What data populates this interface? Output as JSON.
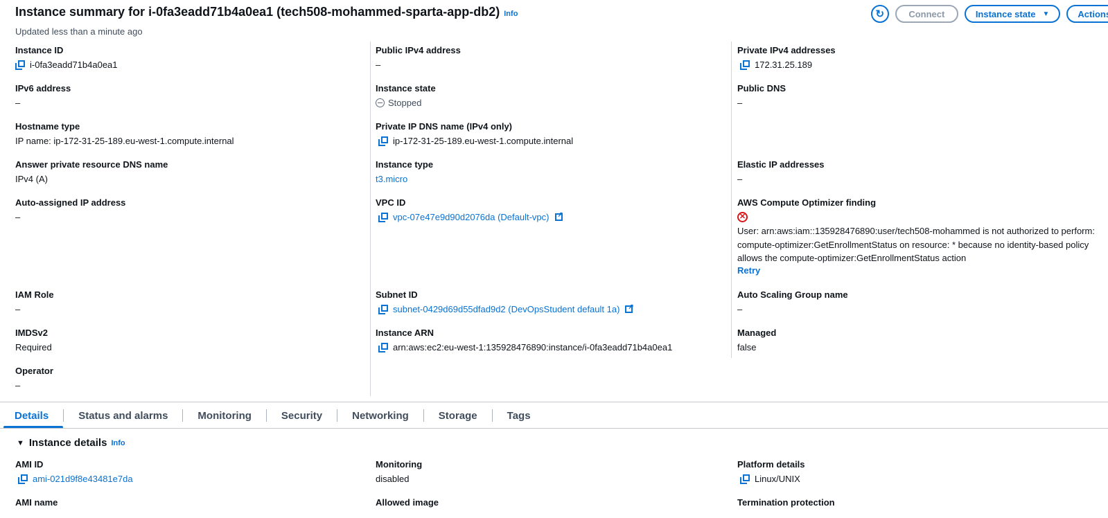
{
  "header": {
    "title": "Instance summary for i-0fa3eadd71b4a0ea1 (tech508-mohammed-sparta-app-db2)",
    "info": "Info",
    "updated": "Updated less than a minute ago"
  },
  "toolbar": {
    "refresh_icon": "refresh-icon",
    "connect": "Connect",
    "instance_state": "Instance state",
    "actions": "Actions"
  },
  "summary": {
    "instance_id": {
      "label": "Instance ID",
      "value": "i-0fa3eadd71b4a0ea1"
    },
    "ipv6": {
      "label": "IPv6 address",
      "value": "–"
    },
    "hostname_type": {
      "label": "Hostname type",
      "value": "IP name: ip-172-31-25-189.eu-west-1.compute.internal"
    },
    "answer_dns": {
      "label": "Answer private resource DNS name",
      "value": "IPv4 (A)"
    },
    "auto_ip": {
      "label": "Auto-assigned IP address",
      "value": "–"
    },
    "iam_role": {
      "label": "IAM Role",
      "value": "–"
    },
    "imdsv2": {
      "label": "IMDSv2",
      "value": "Required"
    },
    "operator": {
      "label": "Operator",
      "value": "–"
    },
    "public_ipv4": {
      "label": "Public IPv4 address",
      "value": "–"
    },
    "instance_state": {
      "label": "Instance state",
      "value": "Stopped"
    },
    "private_dns": {
      "label": "Private IP DNS name (IPv4 only)",
      "value": "ip-172-31-25-189.eu-west-1.compute.internal"
    },
    "instance_type": {
      "label": "Instance type",
      "value": "t3.micro"
    },
    "vpc_id": {
      "label": "VPC ID",
      "value": "vpc-07e47e9d90d2076da (Default-vpc)"
    },
    "subnet_id": {
      "label": "Subnet ID",
      "value": "subnet-0429d69d55dfad9d2 (DevOpsStudent default 1a)"
    },
    "instance_arn": {
      "label": "Instance ARN",
      "value": "arn:aws:ec2:eu-west-1:135928476890:instance/i-0fa3eadd71b4a0ea1"
    },
    "private_ipv4": {
      "label": "Private IPv4 addresses",
      "value": "172.31.25.189"
    },
    "public_dns": {
      "label": "Public DNS",
      "value": "–"
    },
    "elastic_ip": {
      "label": "Elastic IP addresses",
      "value": "–"
    },
    "optimizer": {
      "label": "AWS Compute Optimizer finding",
      "message": "User: arn:aws:iam::135928476890:user/tech508-mohammed is not authorized to perform: compute-optimizer:GetEnrollmentStatus on resource: * because no identity-based policy allows the compute-optimizer:GetEnrollmentStatus action",
      "retry": "Retry"
    },
    "asg_name": {
      "label": "Auto Scaling Group name",
      "value": "–"
    },
    "managed": {
      "label": "Managed",
      "value": "false"
    }
  },
  "tabs": [
    "Details",
    "Status and alarms",
    "Monitoring",
    "Security",
    "Networking",
    "Storage",
    "Tags"
  ],
  "details": {
    "section_title": "Instance details",
    "info": "Info",
    "ami_id": {
      "label": "AMI ID",
      "value": "ami-021d9f8e43481e7da"
    },
    "monitoring": {
      "label": "Monitoring",
      "value": "disabled"
    },
    "platform": {
      "label": "Platform details",
      "value": "Linux/UNIX"
    },
    "ami_name": {
      "label": "AMI name"
    },
    "allowed_image": {
      "label": "Allowed image"
    },
    "termination": {
      "label": "Termination protection"
    }
  },
  "colors": {
    "link": "#0972d3",
    "error": "#d91515",
    "text": "#0f141a"
  }
}
